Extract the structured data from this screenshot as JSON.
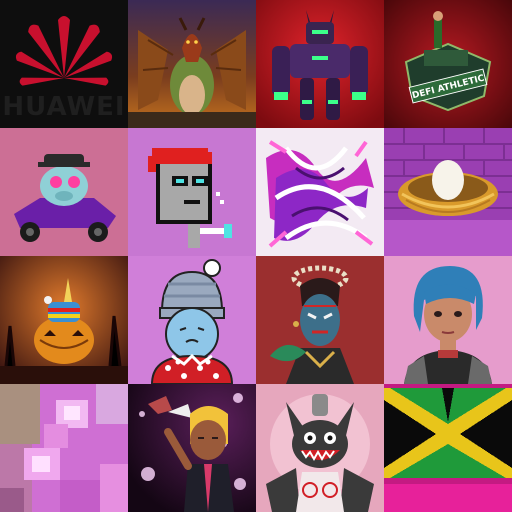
{
  "grid": {
    "tiles": [
      {
        "name": "huawei-logo",
        "text": "HUAWEI",
        "bg": "#0e0e0e",
        "accent": "#c8102e"
      },
      {
        "name": "dragon-art",
        "bg": "#2b1d3a"
      },
      {
        "name": "robot-mech-art",
        "bg": "#b3121b"
      },
      {
        "name": "defi-athletic-badge",
        "text": "DEFI ATHLETIC",
        "bg": "#7a0d12"
      },
      {
        "name": "kart-pig-art",
        "bg": "#cc6f95"
      },
      {
        "name": "pixel-punk-art",
        "bg": "#c777d2"
      },
      {
        "name": "abstract-swirl-art",
        "bg": "#f3eaf3"
      },
      {
        "name": "egg-nest-art",
        "bg": "#9a3fb2"
      },
      {
        "name": "pumpkin-unicorn-art",
        "bg": "#5a2b1f"
      },
      {
        "name": "beanie-cat-art",
        "bg": "#d07fd9"
      },
      {
        "name": "masked-figure-art",
        "bg": "#8e2a2a"
      },
      {
        "name": "anime-girl-art",
        "bg": "#e69ccc"
      },
      {
        "name": "pixel-blur-art",
        "bg": "#cf6fd3"
      },
      {
        "name": "space-kid-art",
        "bg": "#2a0f2d"
      },
      {
        "name": "bat-monster-art",
        "bg": "#e6a7bd"
      },
      {
        "name": "jamaica-flag-pixel-art",
        "bg": "#e7219a"
      }
    ]
  }
}
